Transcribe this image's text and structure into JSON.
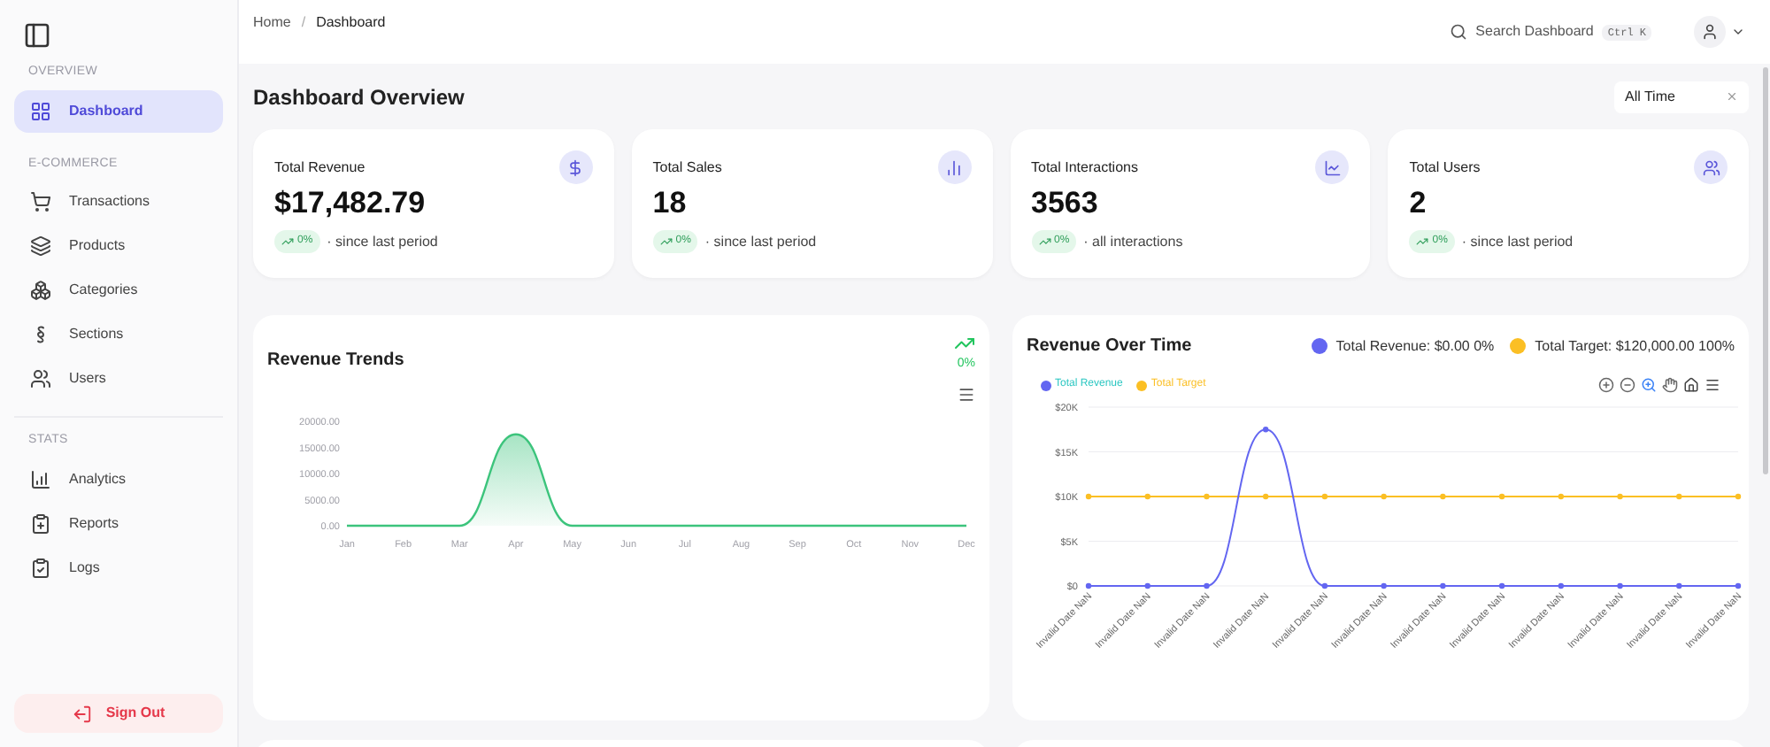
{
  "sidebar": {
    "sections": [
      {
        "title": "OVERVIEW",
        "items": [
          {
            "label": "Dashboard",
            "selected": true
          }
        ]
      },
      {
        "title": "E-COMMERCE",
        "items": [
          {
            "label": "Transactions",
            "selected": false
          },
          {
            "label": "Products",
            "selected": false
          },
          {
            "label": "Categories",
            "selected": false
          },
          {
            "label": "Sections",
            "selected": false
          },
          {
            "label": "Users",
            "selected": false
          }
        ]
      },
      {
        "title": "STATS",
        "items": [
          {
            "label": "Analytics",
            "selected": false
          },
          {
            "label": "Reports",
            "selected": false
          },
          {
            "label": "Logs",
            "selected": false
          }
        ]
      }
    ],
    "sign_out": "Sign Out"
  },
  "breadcrumb": [
    "Home",
    "/",
    "Dashboard"
  ],
  "search": {
    "placeholder": "Search Dashboard",
    "shortcut": "Ctrl K"
  },
  "page_title": "Dashboard Overview",
  "period_filter": "All Time",
  "stats": [
    {
      "title": "Total Revenue",
      "value": "$17,482.79",
      "change": "0%",
      "note": "· since last period"
    },
    {
      "title": "Total Sales",
      "value": "18",
      "change": "0%",
      "note": "· since last period"
    },
    {
      "title": "Total Interactions",
      "value": "3563",
      "change": "0%",
      "note": "· all interactions"
    },
    {
      "title": "Total Users",
      "value": "2",
      "change": "0%",
      "note": "· since last period"
    }
  ],
  "revenue_trends": {
    "trend": "0%",
    "chart_data": {
      "type": "area",
      "title": "Revenue Trends",
      "categories": [
        "Jan",
        "Feb",
        "Mar",
        "Apr",
        "May",
        "Jun",
        "Jul",
        "Aug",
        "Sep",
        "Oct",
        "Nov",
        "Dec"
      ],
      "series": [
        {
          "color": "#3cc47c",
          "values": [
            0,
            0,
            0,
            17500,
            0,
            0,
            0,
            0,
            0,
            0,
            0,
            0
          ]
        }
      ],
      "ylim": [
        0,
        20000
      ],
      "yticks": [
        {
          "value": 0,
          "label": "0.00"
        },
        {
          "value": 5000,
          "label": "5000.00"
        },
        {
          "value": 10000,
          "label": "10000.00"
        },
        {
          "value": 15000,
          "label": "15000.00"
        },
        {
          "value": 20000,
          "label": "20000.00"
        }
      ]
    }
  },
  "revenue_over_time": {
    "summary": [
      {
        "label": "Total Revenue: $0.00 0%",
        "color": "#6366f1"
      },
      {
        "label": "Total Target: $120,000.00 100%",
        "color": "#fbbf24"
      }
    ],
    "chart_data": {
      "type": "line",
      "title": "Revenue Over Time",
      "categories": [
        "Invalid Date NaN",
        "Invalid Date NaN",
        "Invalid Date NaN",
        "Invalid Date NaN",
        "Invalid Date NaN",
        "Invalid Date NaN",
        "Invalid Date NaN",
        "Invalid Date NaN",
        "Invalid Date NaN",
        "Invalid Date NaN",
        "Invalid Date NaN",
        "Invalid Date NaN"
      ],
      "series": [
        {
          "name": "Total Revenue",
          "color": "#6366f1",
          "marker": true,
          "values": [
            0,
            0,
            0,
            17500,
            0,
            0,
            0,
            0,
            0,
            0,
            0,
            0
          ]
        },
        {
          "name": "Total Target",
          "color": "#fbbf24",
          "marker": true,
          "values": [
            10000,
            10000,
            10000,
            10000,
            10000,
            10000,
            10000,
            10000,
            10000,
            10000,
            10000,
            10000
          ]
        }
      ],
      "ylim": [
        0,
        20000
      ],
      "yticks": [
        {
          "value": 0,
          "label": "$0"
        },
        {
          "value": 5000,
          "label": "$5K"
        },
        {
          "value": 10000,
          "label": "$10K"
        },
        {
          "value": 15000,
          "label": "$15K"
        },
        {
          "value": 20000,
          "label": "$20K"
        }
      ]
    }
  }
}
